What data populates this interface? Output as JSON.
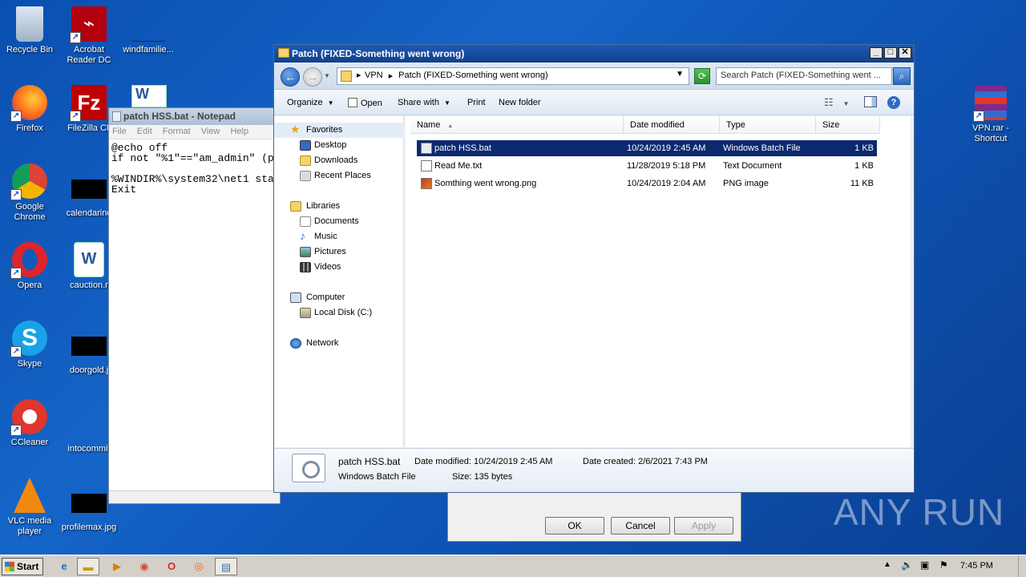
{
  "desktop": {
    "icons_col1": [
      {
        "label": "Recycle Bin",
        "icon": "recycle-bin-icon"
      },
      {
        "label": "Firefox",
        "icon": "firefox-icon"
      },
      {
        "label": "Google\nChrome",
        "icon": "chrome-icon"
      },
      {
        "label": "Opera",
        "icon": "opera-icon"
      },
      {
        "label": "Skype",
        "icon": "skype-icon"
      },
      {
        "label": "CCleaner",
        "icon": "ccleaner-icon"
      },
      {
        "label": "VLC media\nplayer",
        "icon": "vlc-icon"
      }
    ],
    "icons_col2": [
      {
        "label": "Acrobat\nReader DC",
        "icon": "acrobat-icon"
      },
      {
        "label": "FileZilla Cli",
        "icon": "filezilla-icon"
      },
      {
        "label": "calendarind",
        "icon": "image-file-icon"
      },
      {
        "label": "cauction.r",
        "icon": "word-doc-icon"
      },
      {
        "label": "doorgold.j",
        "icon": "image-file-icon"
      },
      {
        "label": "intocommit",
        "icon": "image-file-icon"
      },
      {
        "label": "profilemax.jpg",
        "icon": "image-file-icon"
      }
    ],
    "icon_col3": {
      "label": "windfamilie...",
      "icon": "file-icon"
    },
    "icon_right": {
      "label": "VPN.rar -\nShortcut",
      "icon": "winrar-icon"
    }
  },
  "notepad": {
    "title": "patch HSS.bat - Notepad",
    "menu": [
      "File",
      "Edit",
      "Format",
      "View",
      "Help"
    ],
    "content": "@echo off\nif not \"%1\"==\"am_admin\" (p\n\n%WINDIR%\\system32\\net1 sta\nExit"
  },
  "dialog": {
    "ok": "OK",
    "cancel": "Cancel",
    "apply": "Apply"
  },
  "explorer": {
    "title": "Patch (FIXED-Something went wrong)",
    "breadcrumb": [
      "VPN",
      "Patch (FIXED-Something went wrong)"
    ],
    "search_placeholder": "Search Patch (FIXED-Something went ...",
    "toolbar": {
      "organize": "Organize",
      "open": "Open",
      "share_with": "Share with",
      "print": "Print",
      "new_folder": "New folder"
    },
    "nav": {
      "favorites": "Favorites",
      "desktop": "Desktop",
      "downloads": "Downloads",
      "recent": "Recent Places",
      "libraries": "Libraries",
      "documents": "Documents",
      "music": "Music",
      "pictures": "Pictures",
      "videos": "Videos",
      "computer": "Computer",
      "local_disk": "Local Disk (C:)",
      "network": "Network"
    },
    "columns": [
      "Name",
      "Date modified",
      "Type",
      "Size"
    ],
    "files": [
      {
        "name": "patch HSS.bat",
        "date": "10/24/2019 2:45 AM",
        "type": "Windows Batch File",
        "size": "1 KB"
      },
      {
        "name": "Read Me.txt",
        "date": "11/28/2019 5:18 PM",
        "type": "Text Document",
        "size": "1 KB"
      },
      {
        "name": "Somthing went wrong.png",
        "date": "10/24/2019 2:04 AM",
        "type": "PNG image",
        "size": "11 KB"
      }
    ],
    "details": {
      "name": "patch HSS.bat",
      "type": "Windows Batch File",
      "date_modified_label": "Date modified:",
      "date_modified": "10/24/2019 2:45 AM",
      "date_created_label": "Date created:",
      "date_created": "2/6/2021 7:43 PM",
      "size_label": "Size:",
      "size": "135 bytes"
    }
  },
  "watermark": "ANY RUN",
  "taskbar": {
    "start": "Start",
    "clock": "7:45 PM"
  }
}
